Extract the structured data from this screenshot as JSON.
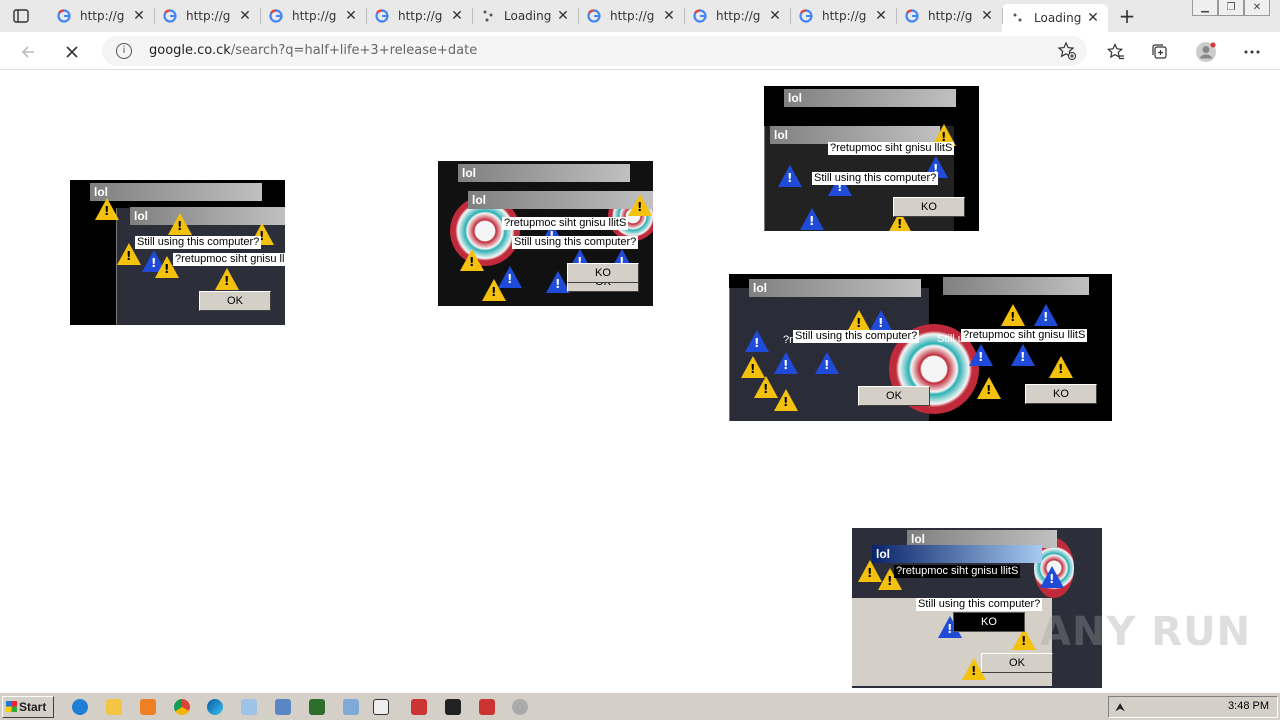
{
  "browser": {
    "tabs": [
      {
        "title": "http://g",
        "favicon": "google-g-icon"
      },
      {
        "title": "http://g",
        "favicon": "google-g-icon"
      },
      {
        "title": "http://g",
        "favicon": "google-g-icon"
      },
      {
        "title": "http://g",
        "favicon": "google-g-icon"
      },
      {
        "title": "Loading",
        "favicon": "loading-spinner-icon"
      },
      {
        "title": "http://g",
        "favicon": "google-g-icon"
      },
      {
        "title": "http://g",
        "favicon": "google-g-icon"
      },
      {
        "title": "http://g",
        "favicon": "google-g-icon"
      },
      {
        "title": "http://g",
        "favicon": "google-g-icon"
      },
      {
        "title": "Loading",
        "favicon": "loading-spinner-icon",
        "active": true
      }
    ],
    "new_tab_label": "+",
    "address": {
      "host": "google.co.ck",
      "path": "/search?q=half+life+3+release+date"
    }
  },
  "popups": [
    {
      "title": "lol",
      "inner_title": "lol",
      "line1": "Still using this computer?",
      "line2": "?retupmoc siht gnisu llitS",
      "button": "OK"
    },
    {
      "title": "lol",
      "inner_title": "lol",
      "line1": "?retupmoc siht gnisu llitS",
      "line2": "Still using this computer?",
      "button": "KO",
      "button2": "OK"
    },
    {
      "title": "lol",
      "inner_title": "lol",
      "line1": "?retupmoc siht gnisu llitS",
      "line2": "Still using this computer?",
      "button": "KO"
    },
    {
      "title": "lol",
      "line1": "Still using this computer?",
      "line2": "?retupmoc siht gnisu llitS",
      "button": "OK",
      "button2": "KO",
      "fragment1": "?re",
      "fragment2": "Still u"
    },
    {
      "title": "lol",
      "inner_title": "lol",
      "line1": "?retupmoc siht gnisu llitS",
      "line2": "Still using this computer?",
      "button": "KO",
      "button2": "OK"
    }
  ],
  "watermark": "ANY RUN",
  "taskbar": {
    "start_label": "Start",
    "clock": "3:48 PM"
  },
  "colors": {
    "warning_yellow": "#f4c20d",
    "info_blue": "#1f4bd8",
    "dialog_grey": "#d4d0c8",
    "title_gradient_start": "#808080"
  }
}
